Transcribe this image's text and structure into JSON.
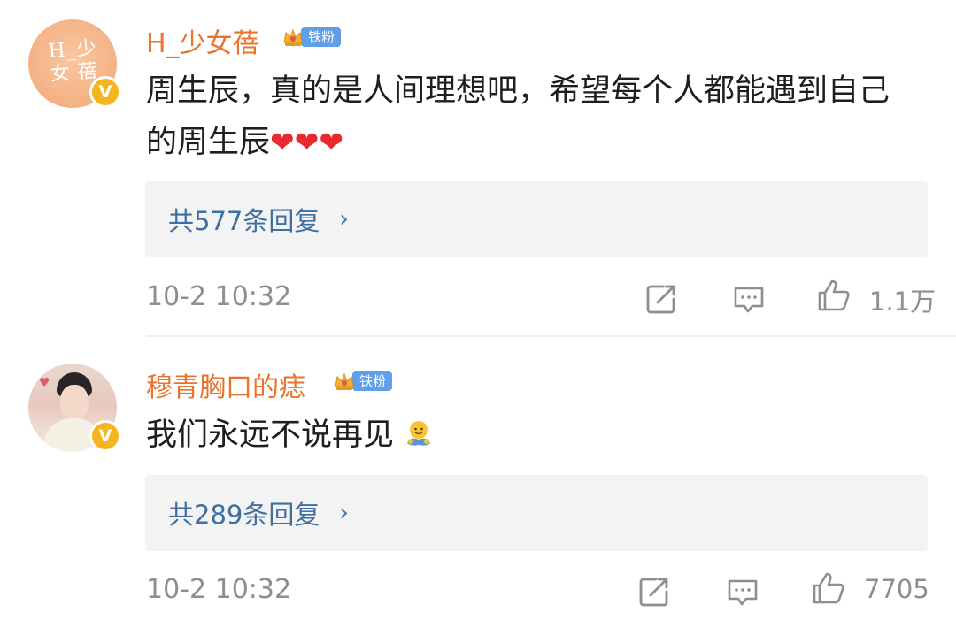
{
  "comments": [
    {
      "username": "H_少女蓓",
      "avatar_text": "H_少女 蓓",
      "verified_mark": "V",
      "fan_badge": "铁粉",
      "text": "周生辰，真的是人间理想吧，希望每个人都能遇到自己的周生辰",
      "emoji": "❤❤❤",
      "replies_label": "共577条回复",
      "replies_chevron": "›",
      "timestamp": "10-2 10:32",
      "likes": "1.1万"
    },
    {
      "username": "穆青胸口的痣",
      "verified_mark": "V",
      "fan_badge": "铁粉",
      "text": "我们永远不说再见",
      "emoji_name": "hug-emoji",
      "replies_label": "共289条回复",
      "replies_chevron": "›",
      "timestamp": "10-2 10:32",
      "likes": "7705"
    }
  ],
  "icons": {
    "share": "share-icon",
    "comment": "comment-icon",
    "like": "like-icon",
    "crown": "crown-icon"
  },
  "colors": {
    "username": "#e8732d",
    "replies_link": "#3f6ea0",
    "meta": "#8e8e8e",
    "fan_badge": "#5f9ee8",
    "verified": "#f5b51c",
    "heart": "#e8292e"
  }
}
